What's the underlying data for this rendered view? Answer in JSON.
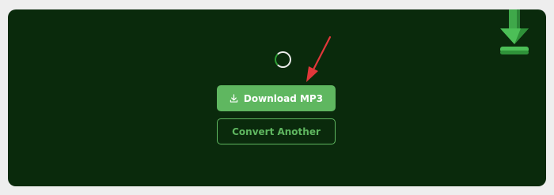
{
  "download_button": {
    "label": "Download MP3",
    "icon": "download-icon"
  },
  "convert_button": {
    "label": "Convert Another"
  },
  "spinner": {
    "icon": "loading-spinner"
  },
  "decor": {
    "icon": "download-arrow-icon"
  },
  "colors": {
    "panel_bg": "#0a2a0c",
    "accent": "#5fb760",
    "annotation_arrow": "#e0373a"
  }
}
